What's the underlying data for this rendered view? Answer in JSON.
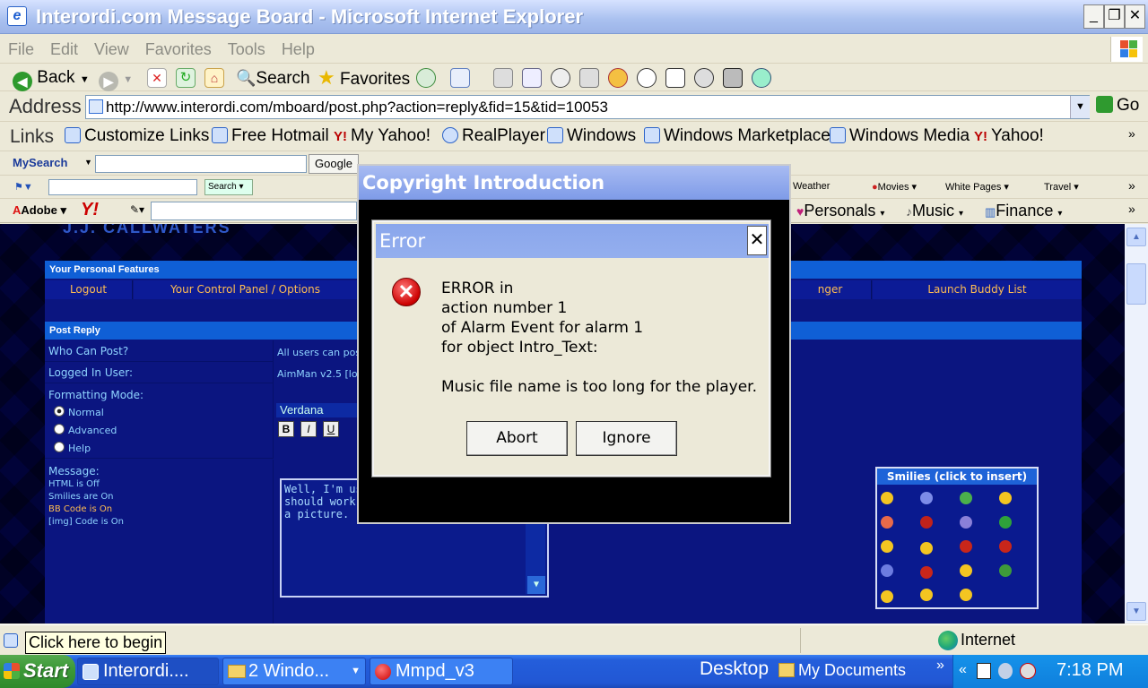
{
  "window": {
    "title": "Interordi.com Message Board - Microsoft Internet Explorer",
    "min": "_",
    "max": "❐",
    "close": "✕"
  },
  "menu": [
    "File",
    "Edit",
    "View",
    "Favorites",
    "Tools",
    "Help"
  ],
  "toolbar": {
    "back": "Back",
    "search": "Search",
    "favorites": "Favorites"
  },
  "address": {
    "label": "Address",
    "url": "http://www.interordi.com/mboard/post.php?action=reply&fid=15&tid=10053",
    "go": "Go"
  },
  "links": {
    "label": "Links",
    "items": [
      "Customize Links",
      "Free Hotmail",
      "My Yahoo!",
      "RealPlayer",
      "Windows",
      "Windows Marketplace",
      "Windows Media",
      "Yahoo!"
    ]
  },
  "mysearch": {
    "brand": "MySearch",
    "google": "Google"
  },
  "bar4": {
    "search": "Search",
    "weather": "Weather",
    "movies": "Movies",
    "white_pages": "White Pages",
    "travel": "Travel"
  },
  "yahoobar": {
    "adobe": "Adobe",
    "yahoo": "Y!",
    "personals": "Personals",
    "music": "Music",
    "finance": "Finance"
  },
  "page": {
    "partial_logo": "J.J. CALLWATERS",
    "features_header": "Your Personal Features",
    "nav": [
      "Logout",
      "Your Control Panel / Options",
      "nger",
      "Launch Buddy List"
    ],
    "post_reply_header": "Post Reply",
    "who_can_post": "Who Can Post?",
    "who_value": "All users can post",
    "logged_in_user": "Logged In User:",
    "user_value": "AimMan v2.5 [lo",
    "formatting_mode": "Formatting Mode:",
    "modes": [
      "Normal",
      "Advanced",
      "Help"
    ],
    "font_select": "Verdana",
    "fmt_buttons": [
      "B",
      "I",
      "U"
    ],
    "message_label": "Message:",
    "html_status": "HTML is Off",
    "smilies_status": "Smilies are On",
    "bbcode_status": "BB Code is On",
    "img_status": "[img] Code is On",
    "message_text": [
      "Well, I'm usin",
      "should work.",
      "a picture."
    ],
    "smilies_header": "Smilies (click to insert)"
  },
  "status": {
    "tooltip": "Click here to begin",
    "zone": "Internet"
  },
  "taskbar": {
    "start": "Start",
    "tasks": [
      "Interordi....",
      "2 Windo...",
      "Mmpd_v3"
    ],
    "desktop": "Desktop",
    "my_documents": "My Documents",
    "clock": "7:18 PM"
  },
  "dialog_outer": {
    "title": "Copyright Introduction"
  },
  "dialog_error": {
    "title": "Error",
    "close": "✕",
    "lines": [
      "ERROR in",
      "action number 1",
      "of Alarm Event for alarm 1",
      "for object Intro_Text:"
    ],
    "detail": "Music file name is too long for the player.",
    "abort": "Abort",
    "ignore": "Ignore"
  },
  "colors": {
    "page_bg": "#0a1466",
    "header_bar": "#0f5fd6",
    "nav_text": "#ffbd52",
    "link_text": "#8fd4ff"
  }
}
